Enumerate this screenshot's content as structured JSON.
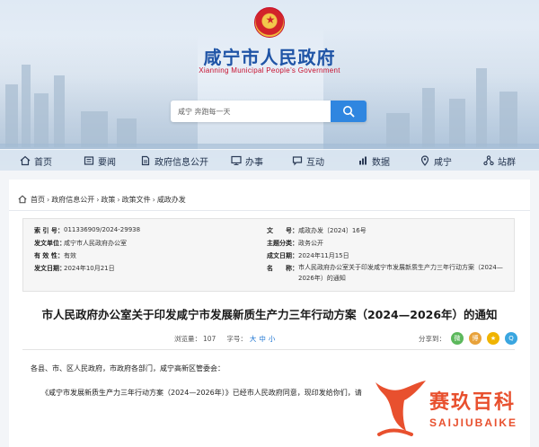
{
  "header": {
    "title": "咸宁市人民政府",
    "subtitle": "Xianning Municipal People’s Government",
    "search": {
      "value": "咸宁 奔跑每一天"
    }
  },
  "nav": {
    "items": [
      {
        "label": "首页",
        "icon": "home-icon"
      },
      {
        "label": "要闻",
        "icon": "news-icon"
      },
      {
        "label": "政府信息公开",
        "icon": "document-icon"
      },
      {
        "label": "办事",
        "icon": "monitor-icon"
      },
      {
        "label": "互动",
        "icon": "chat-icon"
      },
      {
        "label": "数据",
        "icon": "chart-icon"
      },
      {
        "label": "咸宁",
        "icon": "map-pin-icon"
      },
      {
        "label": "站群",
        "icon": "network-icon"
      }
    ]
  },
  "breadcrumb": [
    "首页",
    "政府信息公开",
    "政策",
    "政策文件",
    "咸政办发"
  ],
  "meta": {
    "index_label": "索 引 号：",
    "index_value": "011336909/2024-29938",
    "unit_label": "发文单位：",
    "unit_value": "咸宁市人民政府办公室",
    "validity_label": "有 效 性：",
    "validity_value": "有效",
    "date_label": "发文日期：",
    "date_value": "2024年10月21日",
    "docno_label": "文　　号：",
    "docno_value": "咸政办发〔2024〕16号",
    "category_label": "主题分类：",
    "category_value": "政务公开",
    "issued_label": "成文日期：",
    "issued_value": "2024年11月15日",
    "name_label": "名　　称：",
    "name_value": "市人民政府办公室关于印发咸宁市发展新质生产力三年行动方案（2024—2026年）的通知"
  },
  "document": {
    "title": "市人民政府办公室关于印发咸宁市发展新质生产力三年行动方案（2024—2026年）的通知",
    "views_label": "浏览量：",
    "views": "107",
    "font_label": "字号：",
    "font_large": "大",
    "font_medium": "中",
    "font_small": "小",
    "share_label": "分享到：",
    "addressee": "各县、市、区人民政府，市政府各部门，咸宁高新区管委会：",
    "body": "《咸宁市发展新质生产力三年行动方案（2024—2026年）》已经市人民政府同意，现印发给你们，请"
  },
  "share_icons": [
    {
      "name": "wechat-icon",
      "color": "#5cb85c",
      "glyph": "微"
    },
    {
      "name": "weibo-icon",
      "color": "#e8a23a",
      "glyph": "博"
    },
    {
      "name": "qzone-icon",
      "color": "#f0b400",
      "glyph": "★"
    },
    {
      "name": "qq-icon",
      "color": "#3aa6e0",
      "glyph": "Q"
    }
  ],
  "watermark": {
    "text": "赛玖百科",
    "sub": "SAIJIUBAIKE"
  },
  "colors": {
    "primary": "#1f54a6",
    "accent_red": "#c8102e",
    "link_blue": "#1a73d2",
    "watermark": "#e8502e"
  }
}
